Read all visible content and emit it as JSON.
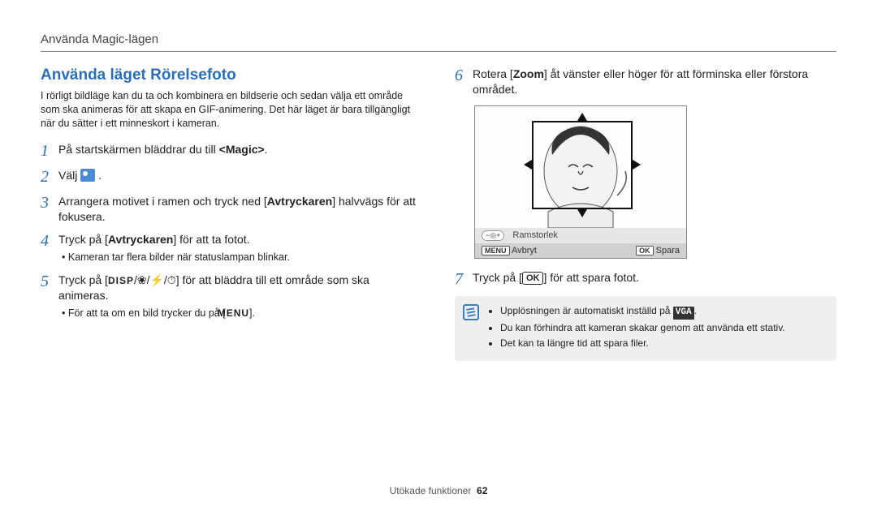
{
  "chapter": "Använda Magic-lägen",
  "heading": "Använda läget Rörelsefoto",
  "intro": "I rörligt bildläge kan du ta och kombinera en bildserie och sedan välja ett område som ska animeras för att skapa en GIF-animering. Det här läget är bara tillgängligt när du sätter i ett minneskort i kameran.",
  "steps": {
    "s1": {
      "pre": "På startskärmen bläddrar du till ",
      "bold": "<Magic>",
      "post": "."
    },
    "s2": {
      "pre": "Välj ",
      "post": " ."
    },
    "s3": {
      "a": "Arrangera motivet i ramen och tryck ned [",
      "b": "Avtryckaren",
      "c": "] halvvägs för att fokusera."
    },
    "s4": {
      "a": "Tryck på [",
      "b": "Avtryckaren",
      "c": "] för att ta fotot.",
      "sub": "Kameran tar flera bilder när statuslampan blinkar."
    },
    "s5": {
      "a": "Tryck på [",
      "icons_sep": "/",
      "c": "] för att bläddra till ett område som ska animeras.",
      "sub_a": "För att ta om en bild trycker du på [",
      "sub_b": "]."
    },
    "s6": {
      "a": "Rotera [",
      "b": "Zoom",
      "c": "] åt vänster eller höger för att förminska eller förstora området."
    },
    "s7": {
      "a": "Tryck på [",
      "c": "] för att spara fotot."
    }
  },
  "lcd": {
    "framesize": "Ramstorlek",
    "cancel": "Avbryt",
    "save": "Spara",
    "menu": "MENU",
    "ok": "OK"
  },
  "notes": {
    "n1a": "Upplösningen är automatiskt inställd på ",
    "n1b": ".",
    "n2": "Du kan förhindra att kameran skakar genom att använda ett stativ.",
    "n3": "Det kan ta längre tid att spara filer."
  },
  "icons": {
    "disp": "DISP",
    "menu": "MENU",
    "ok": "OK",
    "vga": "VGA"
  },
  "footer": {
    "section": "Utökade funktioner",
    "page": "62"
  }
}
